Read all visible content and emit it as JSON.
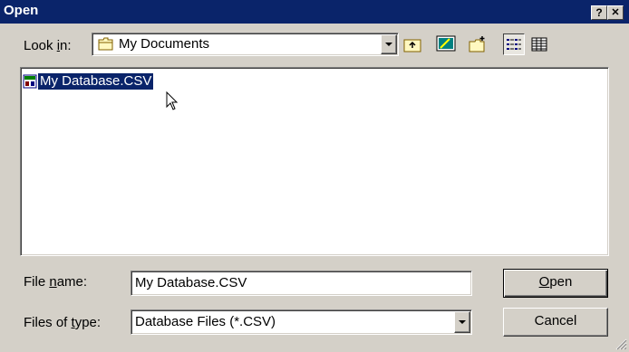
{
  "window": {
    "title": "Open",
    "help_label": "?",
    "close_label": "✕"
  },
  "lookin": {
    "label_pre": "Look ",
    "label_key": "i",
    "label_post": "n:",
    "value": "My Documents"
  },
  "toolbar": {
    "icons": [
      "up-one-level-icon",
      "desktop-icon",
      "new-folder-icon",
      "list-view-icon",
      "details-view-icon"
    ]
  },
  "files": {
    "items": [
      {
        "name": "My Database.CSV",
        "icon": "csv-file-icon",
        "selected": true
      }
    ]
  },
  "filename": {
    "label_pre": "File ",
    "label_key": "n",
    "label_post": "ame:",
    "value": "My Database.CSV"
  },
  "filetype": {
    "label_pre": "Files of ",
    "label_key": "t",
    "label_post": "ype:",
    "value": "Database Files (*.CSV)"
  },
  "buttons": {
    "open_key": "O",
    "open_rest": "pen",
    "cancel": "Cancel"
  },
  "colors": {
    "titlebar": "#0a246a",
    "selection": "#0a246a",
    "face": "#d4d0c8"
  }
}
